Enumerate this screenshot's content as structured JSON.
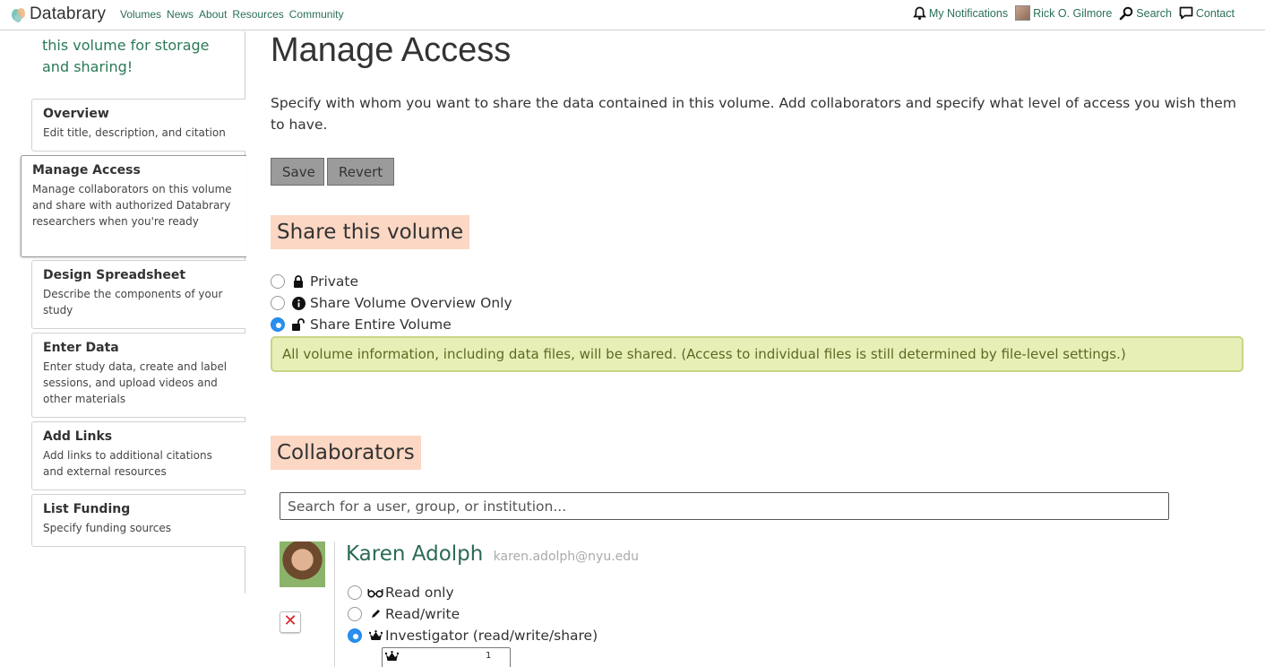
{
  "nav": {
    "logo_text": "Databrary",
    "links": [
      "Volumes",
      "News",
      "About",
      "Resources",
      "Community"
    ],
    "notifications": "My Notifications",
    "user": "Rick O. Gilmore",
    "search": "Search",
    "contact": "Contact"
  },
  "sidebar": {
    "intro": "this volume for storage and sharing!",
    "steps": [
      {
        "title": "Overview",
        "desc": "Edit title, description, and citation"
      },
      {
        "title": "Manage Access",
        "desc": "Manage collaborators on this volume and share with authorized Databrary researchers when you're ready"
      },
      {
        "title": "Design Spreadsheet",
        "desc": "Describe the components of your study"
      },
      {
        "title": "Enter Data",
        "desc": "Enter study data, create and label sessions, and upload videos and other materials"
      },
      {
        "title": "Add Links",
        "desc": "Add links to additional citations and external resources"
      },
      {
        "title": "List Funding",
        "desc": "Specify funding sources"
      }
    ]
  },
  "main": {
    "title": "Manage Access",
    "intro": "Specify with whom you want to share the data contained in this volume. Add collaborators and specify what level of access you wish them to have.",
    "save_label": "Save",
    "revert_label": "Revert",
    "share_heading": "Share this volume",
    "share_options": [
      "Private",
      "Share Volume Overview Only",
      "Share Entire Volume"
    ],
    "share_selected": "Share Entire Volume",
    "notice": "All volume information, including data files, will be shared. (Access to individual files is still determined by file-level settings.)",
    "collab_heading": "Collaborators",
    "search_placeholder": "Search for a user, group, or institution...",
    "collaborator": {
      "name": "Karen Adolph",
      "email": "karen.adolph@nyu.edu",
      "access_options": [
        "Read only",
        "Read/write",
        "Investigator (read/write/share)"
      ],
      "access_selected": "Investigator (read/write/share)",
      "level_box_value": "1"
    }
  },
  "colors": {
    "accent_green": "#2a7a56",
    "section_highlight": "#fbd7c4",
    "notice_bg": "#e8efb6",
    "radio_blue": "#2a8ef0"
  }
}
